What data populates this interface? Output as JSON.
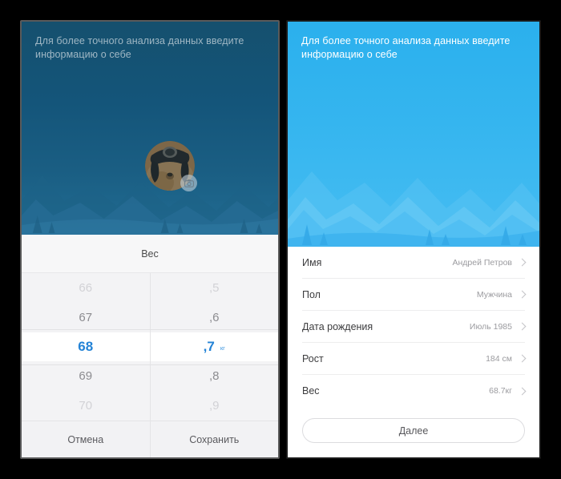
{
  "screen": {
    "background_color": "#000000",
    "panels": [
      "weight-picker-screen",
      "profile-form-screen"
    ]
  },
  "left_panel": {
    "hero": {
      "title": "Для более точного анализа данных введите информацию о себе",
      "title_color": "#9fb7c4",
      "background_top": "#15506e",
      "background_bottom": "#216c93"
    },
    "avatar": {
      "name": "user-avatar",
      "camera_badge_icon": "camera-icon"
    },
    "picker": {
      "title": "Вес",
      "whole_values": [
        "66",
        "67",
        "68",
        "69",
        "70"
      ],
      "whole_selected_index": 2,
      "decimal_values": [
        ",5",
        ",6",
        ",7",
        ",8",
        ",9"
      ],
      "decimal_selected_index": 2,
      "unit": "кг",
      "selected_color": "#2483d6",
      "cancel_label": "Отмена",
      "save_label": "Сохранить"
    }
  },
  "right_panel": {
    "hero": {
      "title": "Для более точного анализа данных введите информацию о себе",
      "title_color": "#ffffff",
      "background_top": "#2bb0ed",
      "background_bottom": "#46bdf2"
    },
    "avatar": {
      "name": "user-avatar",
      "camera_badge_icon": "camera-icon"
    },
    "list": {
      "rows": [
        {
          "label": "Имя",
          "value": "Андрей Петров"
        },
        {
          "label": "Пол",
          "value": "Мужчина"
        },
        {
          "label": "Дата рождения",
          "value": "Июль 1985"
        },
        {
          "label": "Рост",
          "value": "184 см"
        },
        {
          "label": "Вес",
          "value": "68.7кг"
        }
      ],
      "chevron_icon": "chevron-right-icon"
    },
    "next_label": "Далее"
  }
}
